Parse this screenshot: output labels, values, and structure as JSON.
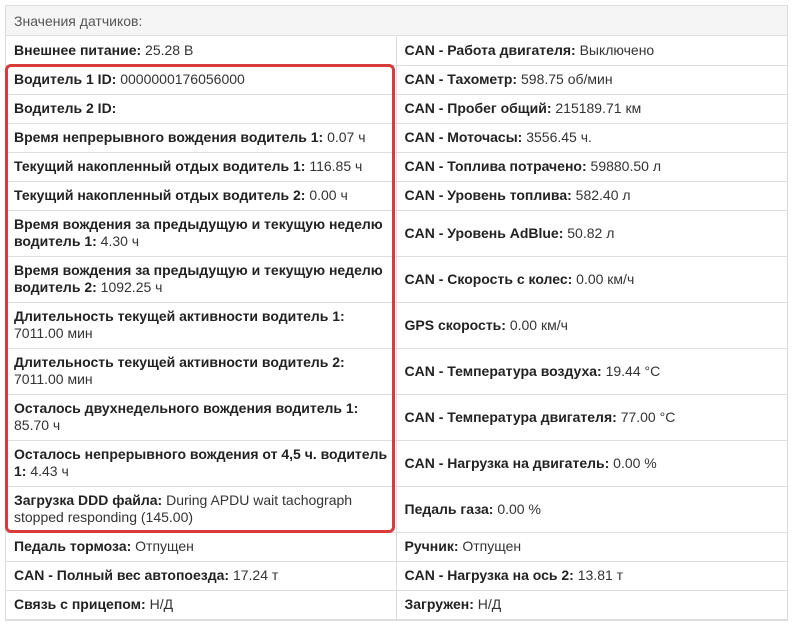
{
  "panel": {
    "title": "Значения датчиков:"
  },
  "rows": [
    {
      "left": {
        "label": "Внешнее питание:",
        "value": "25.28 В"
      },
      "right": {
        "label": "CAN - Работа двигателя:",
        "value": "Выключено"
      }
    },
    {
      "left": {
        "label": "Водитель 1 ID:",
        "value": "0000000176056000"
      },
      "right": {
        "label": "CAN - Тахометр:",
        "value": "598.75 об/мин"
      }
    },
    {
      "left": {
        "label": "Водитель 2 ID:",
        "value": ""
      },
      "right": {
        "label": "CAN - Пробег общий:",
        "value": "215189.71 км"
      }
    },
    {
      "left": {
        "label": "Время непрерывного вождения водитель 1:",
        "value": "0.07 ч"
      },
      "right": {
        "label": "CAN - Моточасы:",
        "value": "3556.45 ч."
      }
    },
    {
      "left": {
        "label": "Текущий накопленный отдых водитель 1:",
        "value": "116.85 ч"
      },
      "right": {
        "label": "CAN - Топлива потрачено:",
        "value": "59880.50 л"
      }
    },
    {
      "left": {
        "label": "Текущий накопленный отдых водитель 2:",
        "value": "0.00 ч"
      },
      "right": {
        "label": "CAN - Уровень топлива:",
        "value": "582.40 л"
      }
    },
    {
      "left": {
        "label": "Время вождения за предыдущую и текущую неделю водитель 1:",
        "value": "4.30 ч"
      },
      "right": {
        "label": "CAN - Уровень AdBlue:",
        "value": "50.82 л"
      }
    },
    {
      "left": {
        "label": "Время вождения за предыдущую и текущую неделю водитель 2:",
        "value": "1092.25 ч"
      },
      "right": {
        "label": "CAN - Скорость с колес:",
        "value": "0.00 км/ч"
      }
    },
    {
      "left": {
        "label": "Длительность текущей активности водитель 1:",
        "value": "7011.00 мин"
      },
      "right": {
        "label": "GPS скорость:",
        "value": "0.00 км/ч"
      }
    },
    {
      "left": {
        "label": "Длительность текущей активности водитель 2:",
        "value": "7011.00 мин"
      },
      "right": {
        "label": "CAN - Температура воздуха:",
        "value": "19.44 °C"
      }
    },
    {
      "left": {
        "label": "Осталось двухнедельного вождения водитель 1:",
        "value": "85.70 ч"
      },
      "right": {
        "label": "CAN - Температура двигателя:",
        "value": "77.00 °C"
      }
    },
    {
      "left": {
        "label": "Осталось непрерывного вождения от 4,5 ч. водитель 1:",
        "value": "4.43 ч"
      },
      "right": {
        "label": "CAN - Нагрузка на двигатель:",
        "value": "0.00 %"
      }
    },
    {
      "left": {
        "label": "Загрузка DDD файла:",
        "value": "During APDU wait tachograph stopped responding (145.00)"
      },
      "right": {
        "label": "Педаль газа:",
        "value": "0.00 %"
      }
    },
    {
      "left": {
        "label": "Педаль тормоза:",
        "value": "Отпущен"
      },
      "right": {
        "label": "Ручник:",
        "value": "Отпущен"
      }
    },
    {
      "left": {
        "label": "CAN - Полный вес автопоезда:",
        "value": "17.24 т"
      },
      "right": {
        "label": "CAN - Нагрузка на ось 2:",
        "value": "13.81 т"
      }
    },
    {
      "left": {
        "label": "Связь с прицепом:",
        "value": "Н/Д"
      },
      "right": {
        "label": "Загружен:",
        "value": "Н/Д"
      }
    }
  ],
  "colors": {
    "highlight": "#d93a3a",
    "border": "#dddddd",
    "header_bg": "#f5f5f5"
  }
}
